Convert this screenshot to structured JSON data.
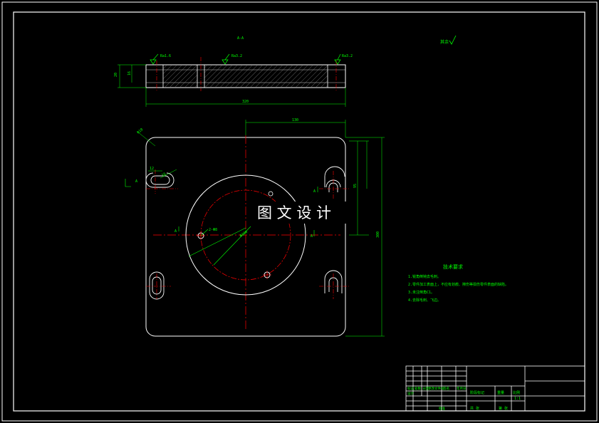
{
  "drawing": {
    "section_label": "A-A",
    "roughness_general": "其余",
    "roughness_marks": [
      "Ra1.6",
      "Ra3.2",
      "Ra3.2"
    ],
    "dimensions": {
      "thickness": "20",
      "overall_width": "320",
      "hole_offset_top": "130",
      "overall_height": "300",
      "right_vertical": "95",
      "small_slot": "12",
      "diameter_circle": "Φ180",
      "small_hole": "2-Φ8",
      "corner_radius": "R10",
      "slot_width": "16"
    },
    "section_markers": [
      "A",
      "A",
      "A",
      "A"
    ],
    "tech_requirements": {
      "title": "技术要求",
      "items": [
        "1.锐角倒钝去毛刺。",
        "2.零件加工表面上，不应有划痕、擦伤等损伤零件表面的缺陷。",
        "3.未注倒角C1。",
        "4.去除毛刺、飞边。"
      ]
    },
    "watermark": "图 文 设 计"
  },
  "title_block": {
    "row_labels": [
      "标记",
      "处数",
      "分区",
      "更改文件号",
      "签名",
      "年月日"
    ],
    "stage_label": "阶段标记",
    "weight_label": "重量",
    "scale_label": "比例",
    "scale_value": "1:1",
    "sheet_label": "共 张",
    "sheet_of": "第 张",
    "designer_label": "设计",
    "approver_label": "批准"
  },
  "colors": {
    "background": "#000000",
    "outline": "#ffffff",
    "dimension": "#00ff00",
    "centerline": "#ff0000",
    "hatch": "#9a9a9a"
  }
}
